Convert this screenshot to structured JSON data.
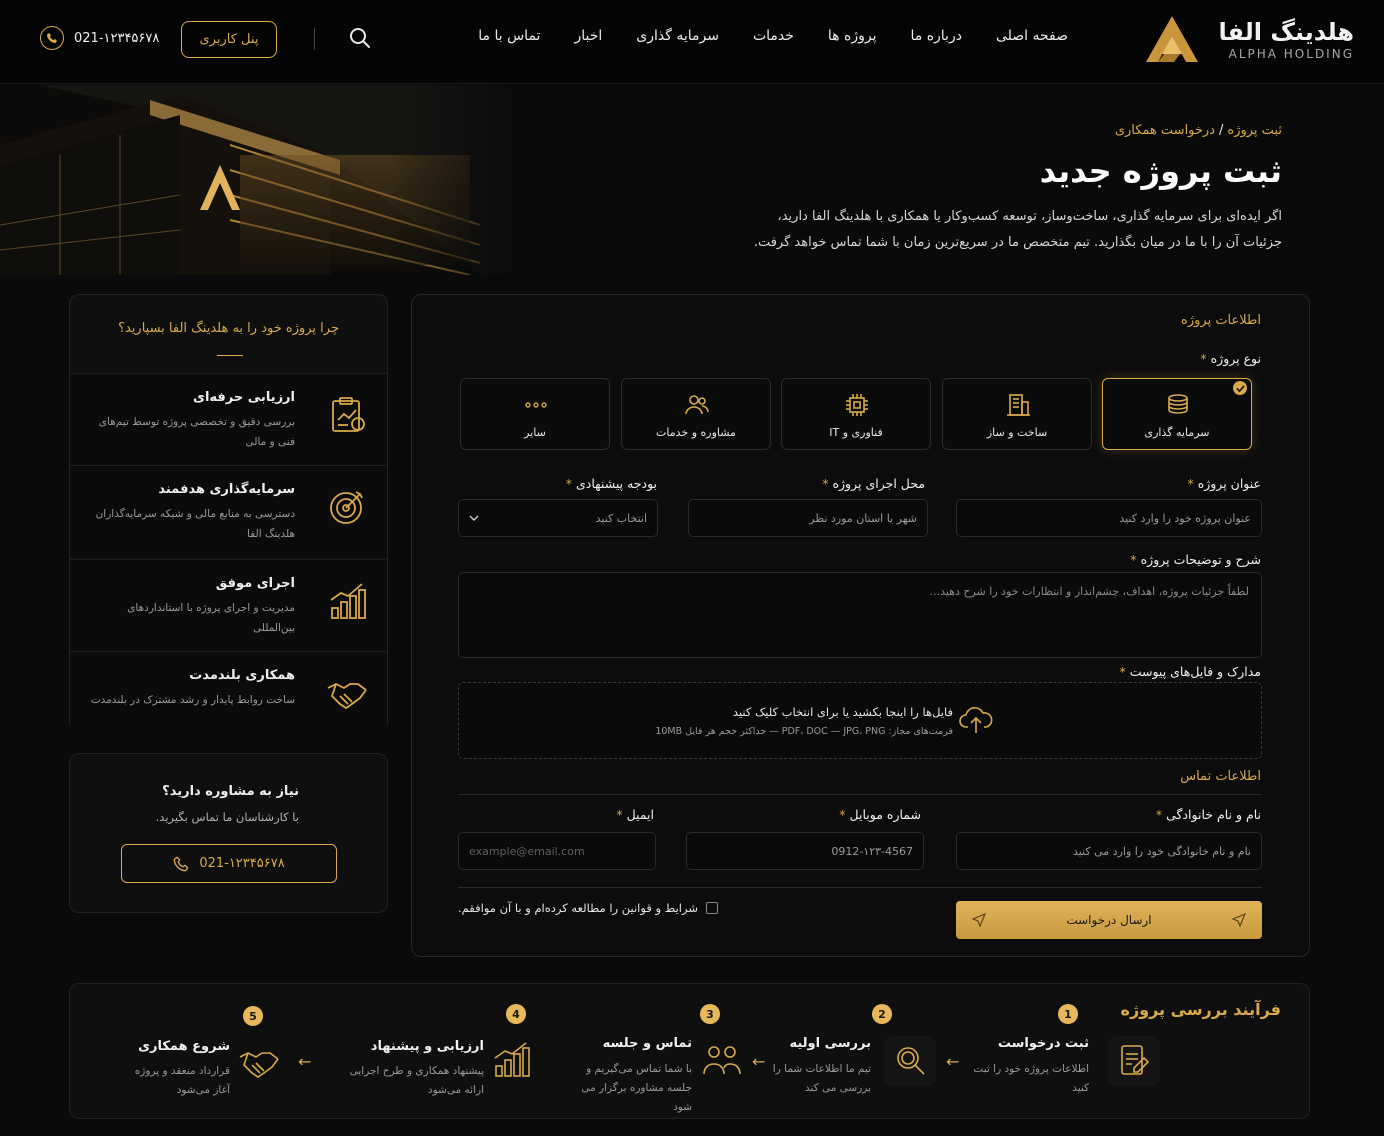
{
  "header": {
    "logo_fa": "هلدینگ الفا",
    "logo_en": "ALPHA HOLDING",
    "nav": [
      "صفحه اصلی",
      "درباره ما",
      "پروژه ها",
      "خدمات",
      "سرمایه گذاری",
      "اخبار",
      "تماس با ما"
    ],
    "panel_button": "پنل کاربری",
    "phone": "021-۱۲۳۴۵۶۷۸",
    "icons": {
      "search": "search-icon",
      "phone": "phone-icon"
    }
  },
  "hero": {
    "breadcrumb_parent": "درخواست همکاری",
    "breadcrumb_current": "ثبت پروژه",
    "title": "ثبت پروژه جدید",
    "description_line1": "اگر ایده‌ای برای سرمایه گذاری، ساخت‌وساز، توسعه کسب‌وکار یا همکاری با هلدینگ الفا دارید،",
    "description_line2": "جزئیات آن را با ما در میان بگذارید. تیم متخصص ما در سریع‌ترین زمان با شما تماس خواهد گرفت."
  },
  "sidebar": {
    "title": "چرا پروژه خود را به هلدینگ الفا بسپارید؟",
    "features": [
      {
        "title": "ارزیابی حرفه‌ای",
        "desc": "بررسی دقیق و تخصصی پروژه توسط تیم‌های فنی و مالی",
        "icon": "clipboard-chart-icon"
      },
      {
        "title": "سرمایه‌گذاری هدفمند",
        "desc": "دسترسی به منابع مالی و شبکه سرمایه‌گذاران هلدینگ الفا",
        "icon": "target-icon"
      },
      {
        "title": "اجرای موفق",
        "desc": "مدیریت و اجرای پروژه با استانداردهای بین‌المللی",
        "icon": "growth-chart-icon"
      },
      {
        "title": "همکاری بلندمدت",
        "desc": "ساخت روابط پایدار و رشد مشترک در بلندمدت",
        "icon": "handshake-icon"
      }
    ],
    "consult": {
      "title": "نیاز به مشاوره دارید؟",
      "subtitle": "با کارشناسان ما تماس بگیرید.",
      "phone": "021-۱۲۳۴۵۶۷۸"
    }
  },
  "form": {
    "project_info_title": "اطلاعات پروژه",
    "project_type_label": "نوع پروژه",
    "project_types": [
      {
        "label": "سرمایه گذاری",
        "icon": "coins-stack-icon",
        "selected": true
      },
      {
        "label": "ساخت و ساز",
        "icon": "building-icon",
        "selected": false
      },
      {
        "label": "فناوری و IT",
        "icon": "chip-icon",
        "selected": false
      },
      {
        "label": "مشاوره و خدمات",
        "icon": "users-icon",
        "selected": false
      },
      {
        "label": "سایر",
        "icon": "dots-icon",
        "selected": false
      }
    ],
    "title_label": "عنوان پروژه",
    "title_placeholder": "عنوان پروژه خود را وارد کنید",
    "location_label": "محل اجرای پروژه",
    "location_placeholder": "شهر یا استان مورد نظر",
    "budget_label": "بودجه پیشنهادی",
    "budget_placeholder": "انتخاب کنید",
    "description_label": "شرح و توضیحات پروژه",
    "description_placeholder": "لطفاً جزئیات پروژه، اهداف، چشم‌انداز و انتظارات خود را شرح دهید...",
    "attachments_label": "مدارک و فایل‌های پیوست",
    "dropzone_title": "فایل‌ها را اینجا بکشید یا برای انتخاب کلیک کنید",
    "dropzone_sub": "فرمت‌های مجاز: PDF، DOC — JPG، PNG — حداکثر حجم هر فایل 10MB",
    "contact_title": "اطلاعات تماس",
    "name_label": "نام و نام خانوادگی",
    "name_placeholder": "نام و نام خانوادگی خود را وارد می کنید",
    "mobile_label": "شماره موبایل",
    "mobile_placeholder": "0912-۱۲۳-4567",
    "email_label": "ایمیل",
    "email_placeholder": "example@email.com",
    "terms": "شرایط و قوانین را مطالعه کرده‌ام و با آن موافقم.",
    "submit": "ارسال درخواست",
    "required_mark": "*"
  },
  "process": {
    "title": "فرآیند بررسی پروژه",
    "steps": [
      {
        "num": "1",
        "title": "ثبت درخواست",
        "desc": "اطلاعات پروژه خود را ثبت کنید",
        "icon": "form-edit-icon"
      },
      {
        "num": "2",
        "title": "بررسی اولیه",
        "desc": "تیم ما اطلاعات شما را بررسی می کند",
        "icon": "magnifier-icon"
      },
      {
        "num": "3",
        "title": "تماس و جلسه",
        "desc": "با شما تماس می‌گیریم و جلسه مشاوره برگزار می شود",
        "icon": "team-icon"
      },
      {
        "num": "4",
        "title": "ارزیابی و پیشنهاد",
        "desc": "پیشنهاد همکاری و طرح اجرایی ارائه می‌شود",
        "icon": "bar-growth-icon"
      },
      {
        "num": "5",
        "title": "شروع همکاری",
        "desc": "قرارداد منعقد و پروژه آغاز می‌شود",
        "icon": "handshake-icon"
      }
    ]
  },
  "colors": {
    "accent": "#d9a94a",
    "background": "#0a0a0a"
  }
}
